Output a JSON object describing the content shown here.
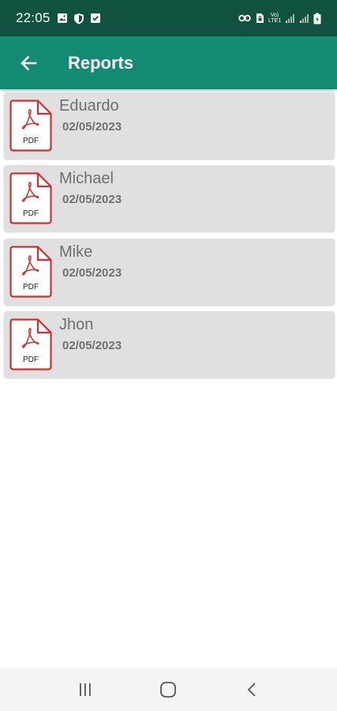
{
  "status_bar": {
    "time": "22:05",
    "left_icons": [
      "image-icon",
      "shield-icon",
      "check-square-icon"
    ],
    "right_icons": [
      "key-icon",
      "sim-lock-icon",
      "volte-icon",
      "signal-icon",
      "signal-icon",
      "battery-icon"
    ],
    "volte_line1": "Vo)",
    "volte_line2": "LTE1"
  },
  "app_bar": {
    "title": "Reports",
    "back_icon": "arrow-left-icon",
    "color": "#138a72",
    "status_color": "#10523f"
  },
  "reports": [
    {
      "name": "Eduardo",
      "date": "02/05/2023",
      "icon": "pdf-file-icon",
      "icon_label": "PDF"
    },
    {
      "name": "Michael",
      "date": "02/05/2023",
      "icon": "pdf-file-icon",
      "icon_label": "PDF"
    },
    {
      "name": "Mike",
      "date": "02/05/2023",
      "icon": "pdf-file-icon",
      "icon_label": "PDF"
    },
    {
      "name": "Jhon",
      "date": "02/05/2023",
      "icon": "pdf-file-icon",
      "icon_label": "PDF"
    }
  ],
  "nav_bar": {
    "buttons": [
      "recent-apps-icon",
      "home-icon",
      "back-chevron-icon"
    ]
  }
}
